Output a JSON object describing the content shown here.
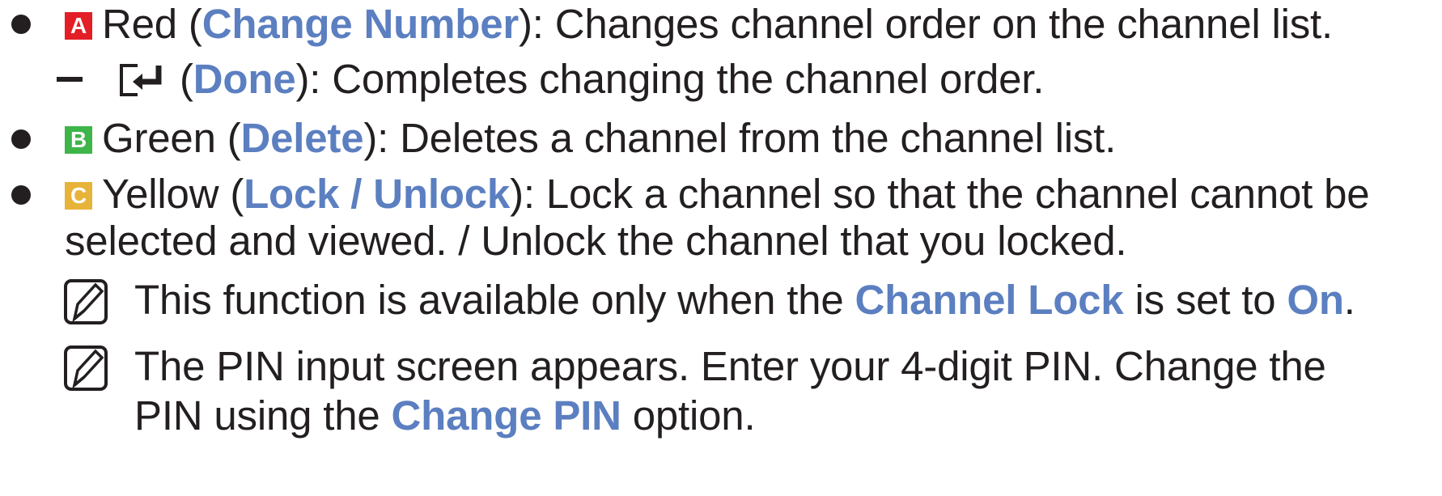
{
  "colors": {
    "text": "#231f20",
    "highlight": "#5b7fc0",
    "red_key": "#e31e26",
    "green_key": "#3db549",
    "yellow_key": "#e7b339"
  },
  "items": [
    {
      "key_letter": "A",
      "color_name": "Red (",
      "action": "Change Number",
      "description": "): Changes channel order on the channel list."
    },
    {
      "key_letter": "B",
      "color_name": "Green (",
      "action": "Delete",
      "description": "): Deletes a channel from the channel list."
    },
    {
      "key_letter": "C",
      "color_name": "Yellow (",
      "action": "Lock / Unlock",
      "description": "): Lock a channel so that the channel cannot be",
      "description_cont": "selected and viewed. / Unlock the channel that you locked."
    }
  ],
  "sub_item": {
    "icon": "enter-icon",
    "open": "(",
    "action": "Done",
    "description": "): Completes changing the channel order."
  },
  "notes": [
    {
      "icon": "note-icon",
      "pre": "This function is available only when the ",
      "hl1": "Channel Lock",
      "mid": " is set to ",
      "hl2": "On",
      "post": "."
    },
    {
      "icon": "note-icon",
      "line1": "The PIN input screen appears. Enter your 4-digit PIN. Change the",
      "pre": "PIN using the ",
      "hl": "Change PIN",
      "post": " option."
    }
  ]
}
